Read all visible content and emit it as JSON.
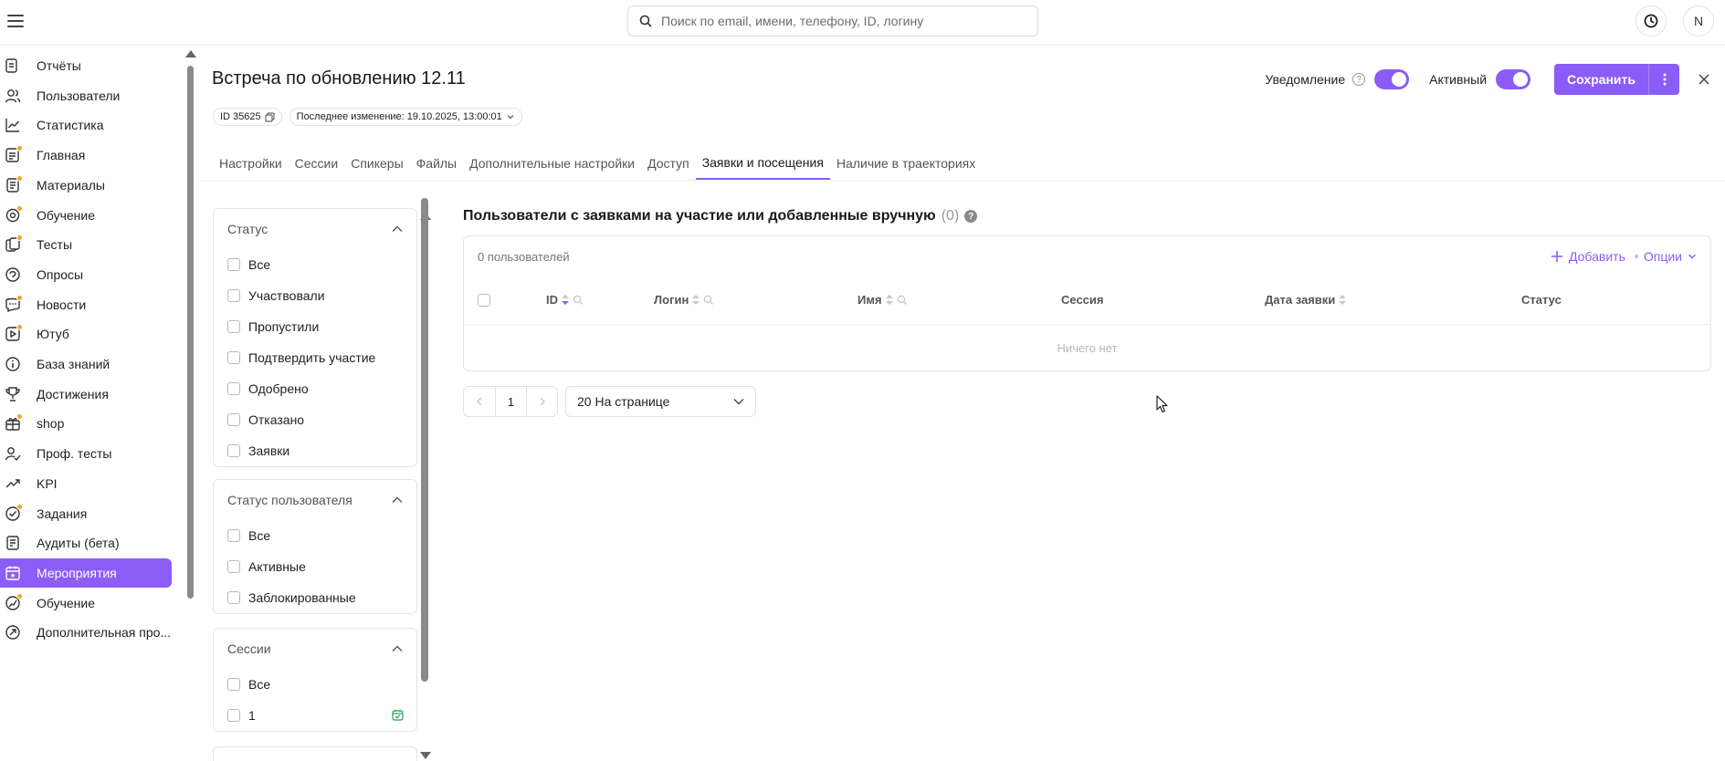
{
  "topbar": {
    "search_placeholder": "Поиск по email, имени, телефону, ID, логину",
    "avatar_letter": "N"
  },
  "sidebar": {
    "items": [
      {
        "label": "Отчёты",
        "icon": "reports-icon",
        "badge": false
      },
      {
        "label": "Пользователи",
        "icon": "users-icon",
        "badge": false
      },
      {
        "label": "Статистика",
        "icon": "chart-icon",
        "badge": false
      },
      {
        "label": "Главная",
        "icon": "home-icon",
        "badge": true
      },
      {
        "label": "Материалы",
        "icon": "materials-icon",
        "badge": true
      },
      {
        "label": "Обучение",
        "icon": "learning-icon",
        "badge": true
      },
      {
        "label": "Тесты",
        "icon": "tests-icon",
        "badge": true
      },
      {
        "label": "Опросы",
        "icon": "polls-icon",
        "badge": false
      },
      {
        "label": "Новости",
        "icon": "news-icon",
        "badge": true
      },
      {
        "label": "Ютуб",
        "icon": "video-icon",
        "badge": true
      },
      {
        "label": "База знаний",
        "icon": "knowledge-icon",
        "badge": false
      },
      {
        "label": "Достижения",
        "icon": "trophy-icon",
        "badge": false
      },
      {
        "label": "shop",
        "icon": "gift-icon",
        "badge": true
      },
      {
        "label": "Проф. тесты",
        "icon": "prof-tests-icon",
        "badge": false
      },
      {
        "label": "KPI",
        "icon": "kpi-icon",
        "badge": false
      },
      {
        "label": "Задания",
        "icon": "tasks-icon",
        "badge": true
      },
      {
        "label": "Аудиты (бета)",
        "icon": "audit-icon",
        "badge": false
      },
      {
        "label": "Мероприятия",
        "icon": "events-icon",
        "badge": false,
        "active": true
      },
      {
        "label": "Обучение",
        "icon": "learning2-icon",
        "badge": true
      },
      {
        "label": "Дополнительная про...",
        "icon": "extra-icon",
        "badge": false
      }
    ]
  },
  "header": {
    "title": "Встреча по обновлению 12.11",
    "id_chip": "ID 35625",
    "last_change": "Последнее изменение: 19.10.2025, 13:00:01",
    "notification_label": "Уведомление",
    "active_label": "Активный",
    "save_label": "Сохранить"
  },
  "tabs": [
    {
      "label": "Настройки"
    },
    {
      "label": "Сессии"
    },
    {
      "label": "Спикеры"
    },
    {
      "label": "Файлы"
    },
    {
      "label": "Дополнительные настройки"
    },
    {
      "label": "Доступ"
    },
    {
      "label": "Заявки и посещения",
      "active": true
    },
    {
      "label": "Наличие в траекториях"
    }
  ],
  "filters": {
    "status": {
      "title": "Статус",
      "options": [
        "Все",
        "Участвовали",
        "Пропустили",
        "Подтвердить участие",
        "Одобрено",
        "Отказано",
        "Заявки"
      ]
    },
    "user_status": {
      "title": "Статус пользователя",
      "options": [
        "Все",
        "Активные",
        "Заблокированные"
      ]
    },
    "sessions": {
      "title": "Сессии",
      "options": [
        "Все",
        "1"
      ]
    }
  },
  "content": {
    "section_title": "Пользователи с заявками на участие или добавленные вручную",
    "section_count": "(0)",
    "users_count": "0 пользователей",
    "add_label": "Добавить",
    "options_label": "Опции",
    "columns": {
      "id": "ID",
      "login": "Логин",
      "name": "Имя",
      "session": "Сессия",
      "date": "Дата заявки",
      "status": "Статус"
    },
    "empty_text": "Ничего нет",
    "page": "1",
    "per_page": "20 На странице"
  },
  "colors": {
    "accent": "#8b5cf6",
    "badge": "#f5a524"
  }
}
